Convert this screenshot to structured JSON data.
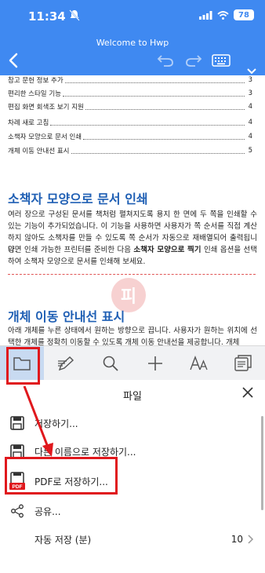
{
  "status": {
    "time": "11:34",
    "battery": "78"
  },
  "app": {
    "title": "Welcome to Hwp"
  },
  "toc": [
    {
      "text": "참고 문헌 정보 추가",
      "page": "3"
    },
    {
      "text": "편리한 스타일 기능",
      "page": "3"
    },
    {
      "text": "편집 화면 회색조 보기 지원",
      "page": "4"
    },
    {
      "text": "차례 새로 고침",
      "page": "4"
    },
    {
      "text": "소책자 모양으로 문서 인쇄",
      "page": "4"
    },
    {
      "text": "개체 이동 안내선 표시",
      "page": "5"
    }
  ],
  "sections": {
    "booklet_heading": "소책자 모양으로 문서 인쇄",
    "booklet_p1": "여러 장으로 구성된 문서를 책처럼 펼쳐지도록 용지 한 면에 두 쪽을 인쇄할 수 있는 기능이 추가되었습니다. 이 기능을 사용하면 사용자가 쪽 순서를 직접 계산하지 않아도 소책자를 만들 수 있도록 쪽 순서가 자동으로 재배열되어 출력됩니다.",
    "booklet_p2_pre": "양면 인쇄 가능한 프린터를 준비한 다음 ",
    "booklet_p2_bold": "소책자 모양으로 찍기",
    "booklet_p2_post": " 인쇄 옵션을 선택하여 소책자 모양으로 문서를 인쇄해 보세요.",
    "guide_heading": "개체 이동 안내선 표시",
    "guide_p1": "아래 개체를 누른 상태에서 원하는 방향으로 끕니다. 사용자가 원하는 위치에 선택한 개체를 정확히 이동할 수 있도록 개체 이동 안내선을 제공합니다. 개체"
  },
  "watermark": "피",
  "toolbar": {
    "tools": [
      {
        "name": "folder-icon",
        "active": true
      },
      {
        "name": "pen-icon",
        "active": false
      },
      {
        "name": "search-icon",
        "active": false
      },
      {
        "name": "plus-icon",
        "active": false
      },
      {
        "name": "font-icon",
        "active": false
      },
      {
        "name": "pages-icon",
        "active": false
      }
    ]
  },
  "file_sheet": {
    "title": "파일",
    "items": [
      {
        "label": "저장하기...",
        "icon": "save-icon"
      },
      {
        "label": "다른 이름으로 저장하기...",
        "icon": "save-as-icon"
      },
      {
        "label": "PDF로 저장하기...",
        "icon": "pdf-icon"
      },
      {
        "label": "공유...",
        "icon": "share-icon"
      },
      {
        "label": "자동 저장 (분)",
        "value": "10",
        "icon": ""
      }
    ]
  },
  "colors": {
    "accent": "#3f89f1",
    "heading": "#1f5fb4",
    "annotation": "#e0181d"
  }
}
